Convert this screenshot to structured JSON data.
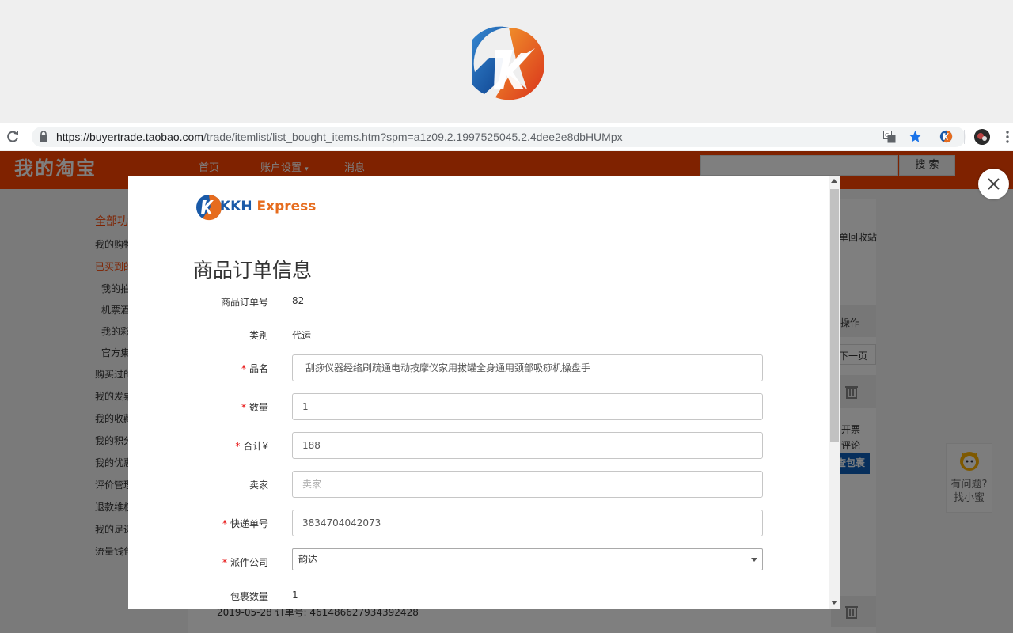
{
  "browser": {
    "url_host": "https://buyertrade.taobao.com",
    "url_path": "/trade/itemlist/list_bought_items.htm?spm=a1z09.2.1997525045.2.4dee2e8dbHUMpx"
  },
  "taobao": {
    "title": "我的淘宝",
    "nav": [
      "首页",
      "账户设置",
      "消息"
    ],
    "search_button": "搜 索",
    "sidebar": [
      "全部功",
      "我的购物",
      "已买到的",
      "我的拍",
      "机票酒",
      "我的彩",
      "官方集",
      "购买过的",
      "我的发票",
      "我的收藏",
      "我的积分",
      "我的优惠",
      "评价管理",
      "退款维权",
      "我的足迹",
      "流量钱包"
    ],
    "right_texts": [
      "单回收站",
      "操作",
      "下一页",
      "开票",
      "评论",
      "查包裹"
    ],
    "blue_button": "查包裹",
    "help": [
      "有问题?",
      "找小蜜"
    ],
    "bottom_row": "2019-05-28   订单号: 461486627934392428"
  },
  "modal": {
    "brand": {
      "kkh": "KKH",
      "express": "Express"
    },
    "title": "商品订单信息",
    "fields": {
      "order_no": {
        "label": "商品订单号",
        "value": "82"
      },
      "category": {
        "label": "类别",
        "value": "代运"
      },
      "product": {
        "label": "品名",
        "value": "刮痧仪器经络刷疏通电动按摩仪家用拔罐全身通用颈部吸痧机操盘手"
      },
      "quantity": {
        "label": "数量",
        "value": "1"
      },
      "total": {
        "label": "合计¥",
        "value": "188"
      },
      "seller": {
        "label": "卖家",
        "placeholder": "卖家"
      },
      "tracking_no": {
        "label": "快递单号",
        "value": "3834704042073"
      },
      "courier": {
        "label": "派件公司",
        "value": "韵达"
      },
      "package_count": {
        "label": "包裹数量",
        "value": "1"
      }
    }
  },
  "colors": {
    "taobao_orange": "#ff4400",
    "brand_blue": "#1a5aa8",
    "brand_orange": "#e66c1e",
    "required_red": "#e60000"
  }
}
